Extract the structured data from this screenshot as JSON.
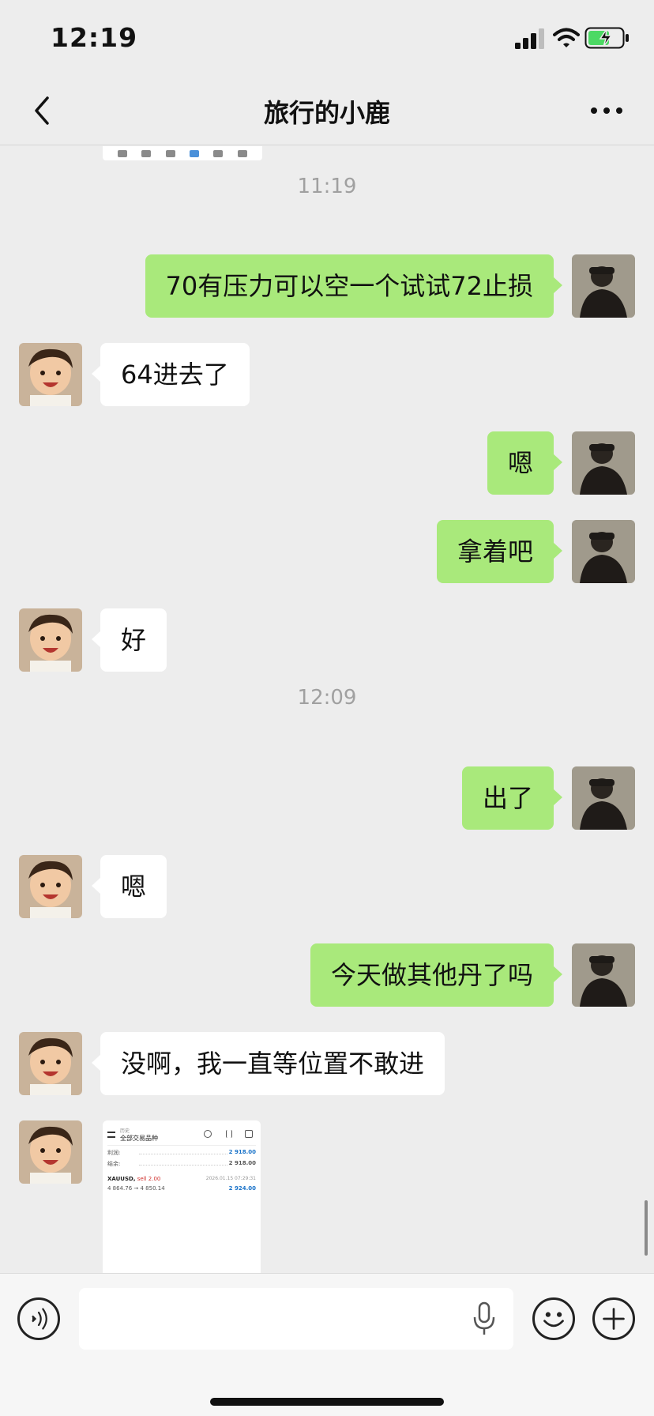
{
  "status_bar": {
    "time": "12:19"
  },
  "nav": {
    "title": "旅行的小鹿"
  },
  "messages": {
    "ts1": "11:19",
    "m1": "70有压力可以空一个试试72止损",
    "m2": "64进去了",
    "m3": "嗯",
    "m4": "拿着吧",
    "m5": "好",
    "ts2": "12:09",
    "m6": "出了",
    "m7": "嗯",
    "m8": "今天做其他丹了吗",
    "m9": "没啊，我一直等位置不敢进"
  },
  "image_message": {
    "small_label": "历史",
    "header_title": "全部交易品种",
    "rows": [
      {
        "label": "利润:",
        "value": "2 918.00"
      },
      {
        "label": "结余:",
        "value": "2 918.00"
      }
    ],
    "trade": {
      "symbol": "XAUUSD,",
      "side": "sell 2.00",
      "date": "2026.01.15 07:29:31",
      "prices": "4 864.76 → 4 850.14",
      "profit": "2 924.00"
    }
  },
  "icons": [
    "back-icon",
    "more-icon",
    "voice-icon",
    "microphone-icon",
    "emoji-icon",
    "plus-icon"
  ],
  "colors": {
    "bubble_me": "#a9e97b",
    "bubble_other": "#ffffff",
    "background": "#ededed"
  }
}
